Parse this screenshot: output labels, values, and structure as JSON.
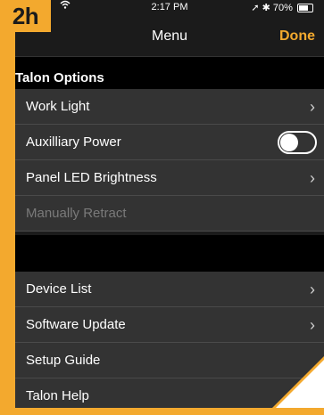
{
  "badge": "2h",
  "status": {
    "time": "2:17 PM",
    "battery": "70%"
  },
  "nav": {
    "title": "Menu",
    "done_label": "Done"
  },
  "section": {
    "title": "Talon Options"
  },
  "options": [
    {
      "label": "Work Light",
      "accessory": "chevron"
    },
    {
      "label": "Auxilliary Power",
      "accessory": "toggle",
      "toggle_on": false
    },
    {
      "label": "Panel LED Brightness",
      "accessory": "chevron"
    },
    {
      "label": "Manually Retract",
      "accessory": "none",
      "disabled": true
    }
  ],
  "more": [
    {
      "label": "Device List",
      "accessory": "chevron"
    },
    {
      "label": "Software Update",
      "accessory": "chevron"
    },
    {
      "label": "Setup Guide",
      "accessory": "none"
    },
    {
      "label": "Talon Help",
      "accessory": "none"
    }
  ],
  "colors": {
    "accent": "#f3a92e",
    "row_bg": "#333333",
    "header_bg": "#000000"
  }
}
